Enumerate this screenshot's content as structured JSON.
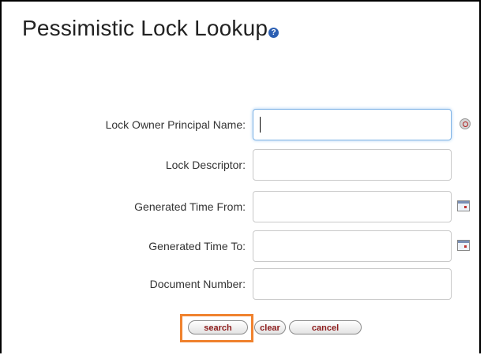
{
  "page": {
    "title": "Pessimistic Lock Lookup",
    "help_glyph": "?"
  },
  "form": {
    "fields": [
      {
        "label": "Lock Owner Principal Name:",
        "value": "",
        "placeholder": "",
        "icon": "lookup-icon"
      },
      {
        "label": "Lock Descriptor:",
        "value": "",
        "placeholder": ""
      },
      {
        "label": "Generated Time From:",
        "value": "",
        "placeholder": "",
        "icon": "calendar-icon"
      },
      {
        "label": "Generated Time To:",
        "value": "",
        "placeholder": "",
        "icon": "calendar-icon"
      },
      {
        "label": "Document Number:",
        "value": "",
        "placeholder": ""
      }
    ]
  },
  "buttons": {
    "search": "search",
    "clear": "clear",
    "cancel": "cancel"
  },
  "colors": {
    "button_text": "#8b1a1a",
    "highlight": "#f0822e",
    "focus_border": "#7fb3e6"
  }
}
